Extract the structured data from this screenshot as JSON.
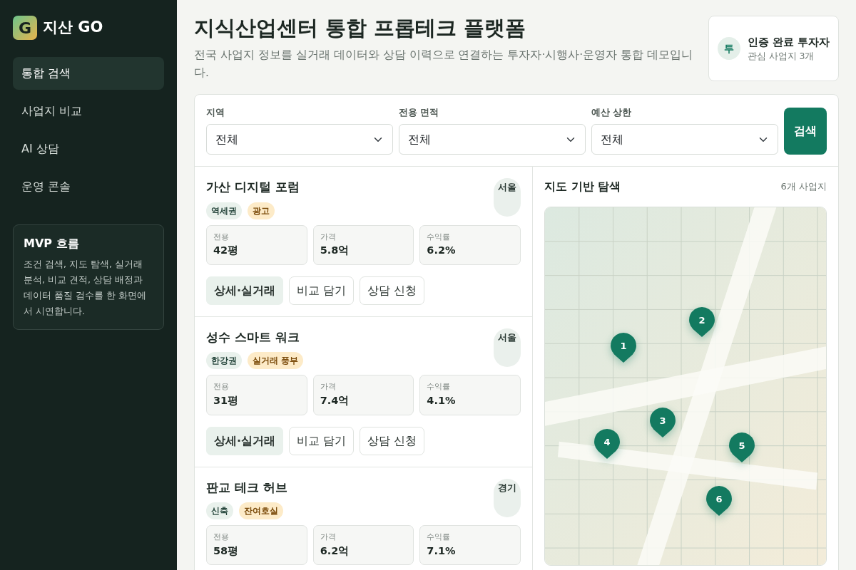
{
  "brand": {
    "logo": "G",
    "name": "지산 GO"
  },
  "nav": [
    {
      "label": "통합 검색",
      "selected": true
    },
    {
      "label": "사업지 비교",
      "selected": false
    },
    {
      "label": "AI 상담",
      "selected": false
    },
    {
      "label": "운영 콘솔",
      "selected": false
    }
  ],
  "info_box": {
    "title": "MVP 흐름",
    "text": "조건 검색, 지도 탐색, 실거래 분석, 비교 견적, 상담 배정과 데이터 품질 검수를 한 화면에서 시연합니다."
  },
  "header": {
    "title": "지식산업센터 통합 프롭테크 플랫폼",
    "subtitle": "전국 사업지 정보를 실거래 데이터와 상담 이력으로 연결하는 투자자·시행사·운영자 통합 데모입니다."
  },
  "user": {
    "avatar": "투",
    "name": "인증 완료 투자자",
    "detail": "관심 사업지 3개"
  },
  "filters": [
    {
      "label": "지역",
      "value": "전체"
    },
    {
      "label": "전용 면적",
      "value": "전체"
    },
    {
      "label": "예산 상한",
      "value": "전체"
    }
  ],
  "search_button": "검색",
  "listings": [
    {
      "name": "가산 디지털 포럼",
      "region": "서울",
      "tags": [
        {
          "text": "역세권",
          "kind": "feature"
        },
        {
          "text": "광고",
          "kind": "highlight"
        }
      ],
      "stats": [
        {
          "label": "전용",
          "value": "42평"
        },
        {
          "label": "가격",
          "value": "5.8억"
        },
        {
          "label": "수익률",
          "value": "6.2%"
        }
      ],
      "actions": [
        "상세·실거래",
        "비교 담기",
        "상담 신청"
      ]
    },
    {
      "name": "성수 스마트 워크",
      "region": "서울",
      "tags": [
        {
          "text": "한강권",
          "kind": "feature"
        },
        {
          "text": "실거래 풍부",
          "kind": "highlight"
        }
      ],
      "stats": [
        {
          "label": "전용",
          "value": "31평"
        },
        {
          "label": "가격",
          "value": "7.4억"
        },
        {
          "label": "수익률",
          "value": "4.1%"
        }
      ],
      "actions": [
        "상세·실거래",
        "비교 담기",
        "상담 신청"
      ]
    },
    {
      "name": "판교 테크 허브",
      "region": "경기",
      "tags": [
        {
          "text": "신축",
          "kind": "feature"
        },
        {
          "text": "잔여호실",
          "kind": "highlight"
        }
      ],
      "stats": [
        {
          "label": "전용",
          "value": "58평"
        },
        {
          "label": "가격",
          "value": "6.2억"
        },
        {
          "label": "수익률",
          "value": "7.1%"
        }
      ]
    }
  ],
  "map": {
    "title": "지도 기반 탐색",
    "count": "6개 사업지",
    "pins": [
      "1",
      "2",
      "3",
      "4",
      "5",
      "6"
    ]
  }
}
